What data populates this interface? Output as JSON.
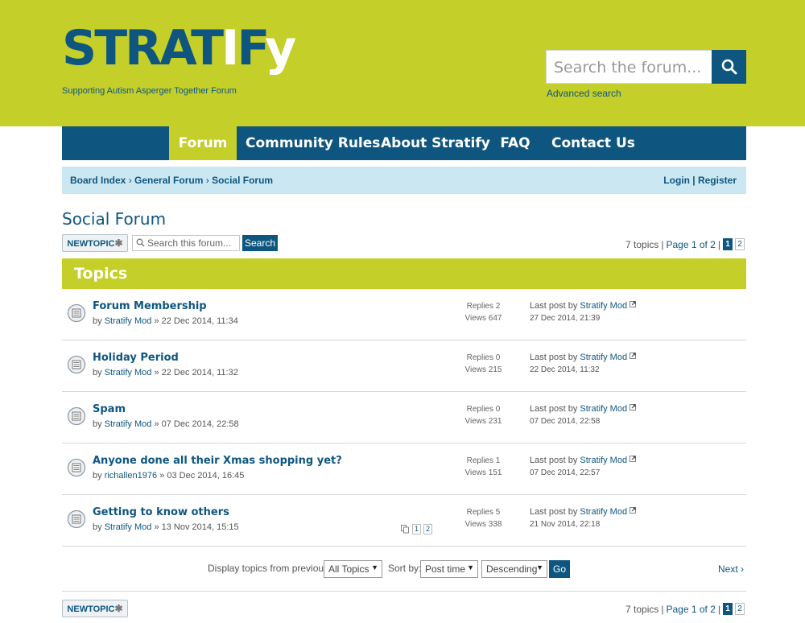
{
  "header": {
    "logo_text": "STRATIFy",
    "tagline": "Supporting Autism Asperger Together Forum",
    "search_placeholder": "Search the forum...",
    "advanced_search": "Advanced search"
  },
  "nav": {
    "items": [
      {
        "label": "Forum"
      },
      {
        "label": "Community Rules"
      },
      {
        "label": "About Stratify"
      },
      {
        "label": "FAQ"
      },
      {
        "label": "Contact Us"
      }
    ]
  },
  "breadcrumb": {
    "items": [
      "Board Index",
      "General Forum",
      "Social Forum"
    ],
    "login": "Login",
    "register": "Register"
  },
  "forum": {
    "title": "Social Forum",
    "new_topic_label": "NEWTOPIC",
    "search_placeholder": "Search this forum...",
    "search_button": "Search",
    "topic_count": "7 topics",
    "page_label": "Page 1 of 2",
    "pages": [
      "1",
      "2"
    ]
  },
  "topics_header": "Topics",
  "topics": [
    {
      "title": "Forum Membership",
      "by": "by",
      "author": "Stratify Mod",
      "date": "» 22 Dec 2014, 11:34",
      "replies": "Replies 2",
      "views": "Views 647",
      "last_prefix": "Last post by",
      "last_author": "Stratify Mod",
      "last_date": "27 Dec 2014, 21:39"
    },
    {
      "title": "Holiday Period",
      "by": "by",
      "author": "Stratify Mod",
      "date": "» 22 Dec 2014, 11:32",
      "replies": "Replies 0",
      "views": "Views 215",
      "last_prefix": "Last post by",
      "last_author": "Stratify Mod",
      "last_date": "22 Dec 2014, 11:32"
    },
    {
      "title": "Spam",
      "by": "by",
      "author": "Stratify Mod",
      "date": "» 07 Dec 2014, 22:58",
      "replies": "Replies 0",
      "views": "Views 231",
      "last_prefix": "Last post by",
      "last_author": "Stratify Mod",
      "last_date": "07 Dec 2014, 22:58"
    },
    {
      "title": "Anyone done all their Xmas shopping yet?",
      "by": "by",
      "author": "richallen1976",
      "date": "» 03 Dec 2014, 16:45",
      "replies": "Replies 1",
      "views": "Views 151",
      "last_prefix": "Last post by",
      "last_author": "Stratify Mod",
      "last_date": "07 Dec 2014, 22:57"
    },
    {
      "title": "Getting to know others",
      "by": "by",
      "author": "Stratify Mod",
      "date": "» 13 Nov 2014, 15:15",
      "replies": "Replies 5",
      "views": "Views 338",
      "last_prefix": "Last post by",
      "last_author": "Stratify Mod",
      "last_date": "21 Nov 2014, 22:18",
      "mini_pages": [
        "1",
        "2"
      ]
    }
  ],
  "controls": {
    "display_label": "Display topics from previous:",
    "display_value": "All Topics",
    "sort_label": "Sort by:",
    "sort_value": "Post time",
    "order_value": "Descending",
    "go": "Go",
    "next": "Next"
  },
  "colors": {
    "brand_green": "#c4cf29",
    "brand_blue": "#0e5680",
    "crumb_bg": "#cbe7f1"
  }
}
